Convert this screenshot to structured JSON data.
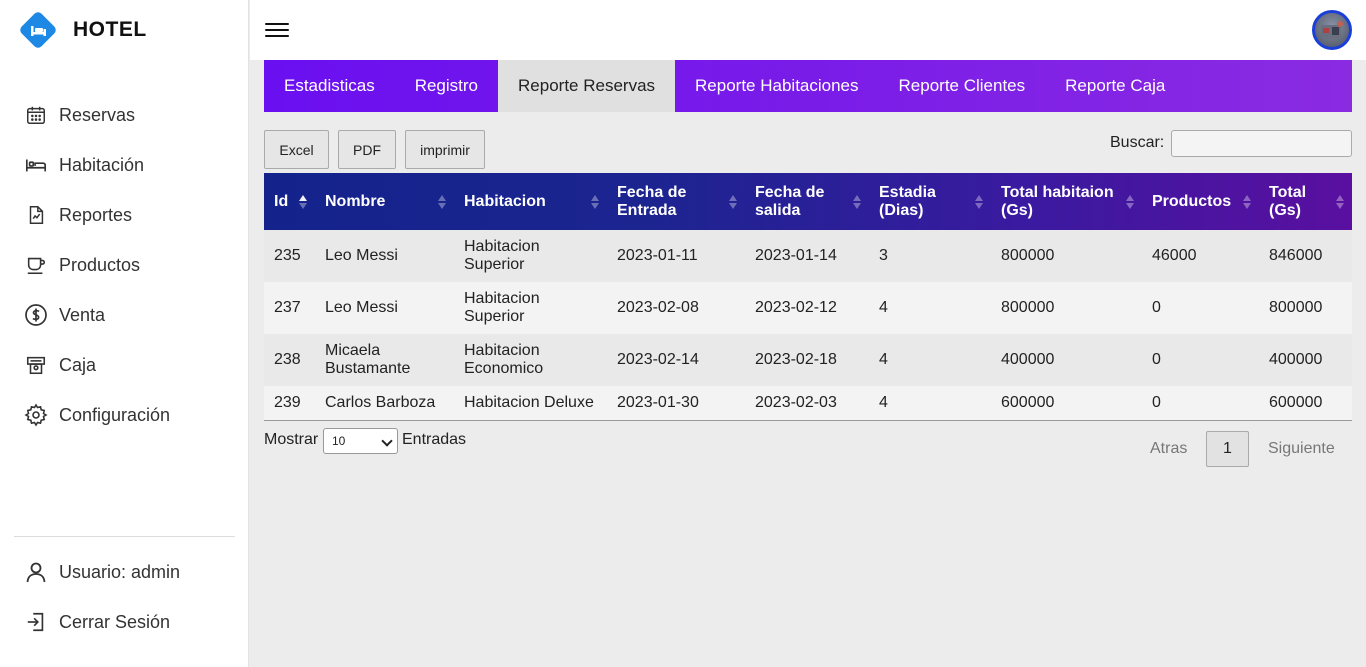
{
  "brand": {
    "name": "HOTEL",
    "logo_color": "#1e88e5"
  },
  "sidebar": {
    "items": [
      {
        "label": "Reservas",
        "icon": "calendar-icon"
      },
      {
        "label": "Habitación",
        "icon": "bed-icon"
      },
      {
        "label": "Reportes",
        "icon": "report-icon"
      },
      {
        "label": "Productos",
        "icon": "cup-icon"
      },
      {
        "label": "Venta",
        "icon": "dollar-icon"
      },
      {
        "label": "Caja",
        "icon": "cash-register-icon"
      },
      {
        "label": "Configuración",
        "icon": "gear-icon"
      }
    ],
    "bottom": [
      {
        "label": "Usuario: admin",
        "icon": "user-icon"
      },
      {
        "label": "Cerrar Sesión",
        "icon": "logout-icon"
      }
    ]
  },
  "tabs": [
    {
      "label": "Estadisticas",
      "active": false
    },
    {
      "label": "Registro",
      "active": false
    },
    {
      "label": "Reporte Reservas",
      "active": true
    },
    {
      "label": "Reporte Habitaciones",
      "active": false
    },
    {
      "label": "Reporte Clientes",
      "active": false
    },
    {
      "label": "Reporte Caja",
      "active": false
    }
  ],
  "toolbar": {
    "excel": "Excel",
    "pdf": "PDF",
    "print": "imprimir",
    "search_label": "Buscar:",
    "search_value": ""
  },
  "table": {
    "columns": [
      "Id",
      "Nombre",
      "Habitacion",
      "Fecha de Entrada",
      "Fecha de salida",
      "Estadia (Dias)",
      "Total habitaion (Gs)",
      "Productos",
      "Total (Gs)"
    ],
    "rows": [
      [
        "235",
        "Leo Messi",
        "Habitacion Superior",
        "2023-01-11",
        "2023-01-14",
        "3",
        "800000",
        "46000",
        "846000"
      ],
      [
        "237",
        "Leo Messi",
        "Habitacion Superior",
        "2023-02-08",
        "2023-02-12",
        "4",
        "800000",
        "0",
        "800000"
      ],
      [
        "238",
        "Micaela Bustamante",
        "Habitacion Economico",
        "2023-02-14",
        "2023-02-18",
        "4",
        "400000",
        "0",
        "400000"
      ],
      [
        "239",
        "Carlos Barboza",
        "Habitacion Deluxe",
        "2023-01-30",
        "2023-02-03",
        "4",
        "600000",
        "0",
        "600000"
      ]
    ]
  },
  "footer": {
    "show_label": "Mostrar",
    "page_size": "10",
    "entries_label": "Entradas",
    "prev": "Atras",
    "page": "1",
    "next": "Siguiente"
  }
}
